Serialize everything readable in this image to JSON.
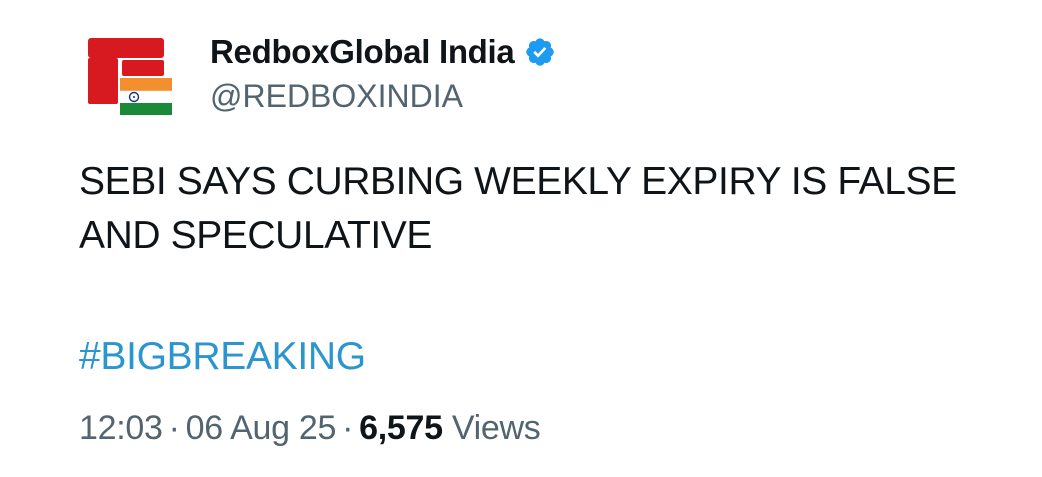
{
  "author": {
    "display_name": "RedboxGlobal India",
    "handle": "@REDBOXINDIA",
    "verified": true,
    "verified_color": "#1d9bf0",
    "avatar_icon": "redbox-india-logo"
  },
  "tweet": {
    "text": "SEBI SAYS CURBING WEEKLY EXPIRY IS FALSE AND SPECULATIVE",
    "hashtag": "#BIGBREAKING",
    "hashtag_color": "#2a95cf"
  },
  "meta": {
    "time": "12:03",
    "separator": "·",
    "date": "06 Aug 25",
    "views_count": "6,575",
    "views_label": "Views"
  }
}
